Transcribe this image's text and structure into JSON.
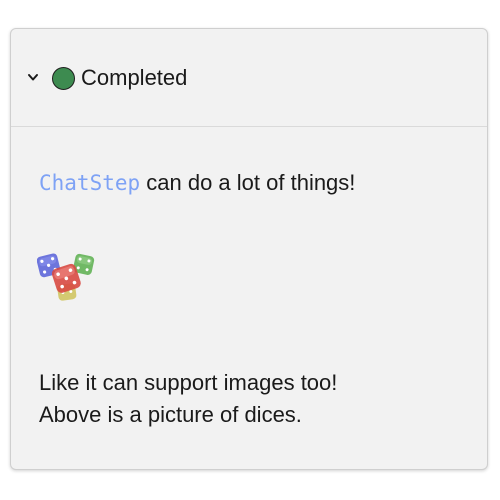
{
  "step": {
    "status_label": "Completed",
    "status_color": "#3d8b50",
    "chevron_icon": "chevron-down-icon"
  },
  "message": {
    "code_token": "ChatStep",
    "code_color": "#7ea2f5",
    "line1_rest": " can do a lot of things!",
    "image_alt": "dice-image",
    "note_line1": "Like it can support images too!",
    "note_line2": "Above is a picture of dices."
  }
}
